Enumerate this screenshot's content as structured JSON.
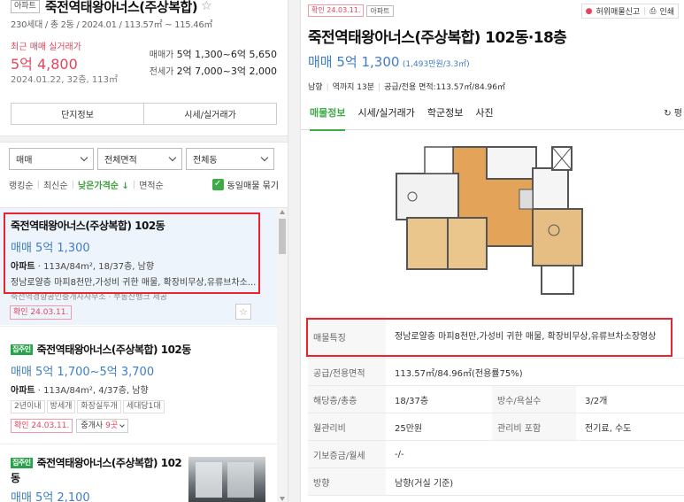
{
  "left": {
    "summary": {
      "type_tag": "아파트",
      "title": "죽전역태왕아너스(주상복합)",
      "sub_info": "230세대 / 총 2동 / 2024.01 / 113.57㎡ ~ 115.46㎡",
      "recent_label": "최근 매매 실거래가",
      "recent_price": "5억 4,800",
      "recent_date": "2024.01.22, 32층, 113㎡",
      "sale_label": "매매가",
      "sale_range": "5억 1,300~6억 5,650",
      "jeonse_label": "전세가",
      "jeonse_range": "2억 7,000~3억 2,000",
      "btn_complex": "단지정보",
      "btn_price": "시세/실거래가"
    },
    "filters": {
      "deal": "매매",
      "area": "전체면적",
      "dong": "전체동"
    },
    "sort": {
      "options": [
        "랭킹순",
        "최신순",
        "낮은가격순 ↓",
        "면적순"
      ],
      "same_listing": "동일매물 묶기"
    },
    "items": [
      {
        "title": "죽전역태왕아너스(주상복합) 102동",
        "price": "매매 5억 1,300",
        "type": "아파트",
        "spec": "113A/84m², 18/37층, 남향",
        "desc": "정남로얄층 마피8천만,가성비 귀한 매물, 확장비무상,유류브차소...",
        "agent": "죽전역경향공인중개사사무소 · 부동산뱅크 제공",
        "confirm": "확인 24.03.11."
      },
      {
        "badge": "집주인",
        "title": "죽전역태왕아너스(주상복합) 102동",
        "price": "매매 5억 1,700~5억 3,700",
        "type": "아파트",
        "spec": "113A/84m², 4/37층, 남향",
        "tags": [
          "2년이내",
          "방세개",
          "화장실두개",
          "세대당1대"
        ],
        "confirm": "확인 24.03.11.",
        "agent_select": "중개사",
        "agent_count": "9곳"
      },
      {
        "badge": "집주인",
        "title": "죽전역태왕아너스(주상복합) 102동",
        "price": "매매 5억 2,100"
      }
    ]
  },
  "detail": {
    "confirm": "확인 24.03.11.",
    "type_tag": "아파트",
    "report": "허위매물신고",
    "print": "인쇄",
    "title": "죽전역태왕아너스(주상복합) 102동·18층",
    "price_big": "매매 5억 1,300",
    "price_small": "(1,493만원/3.3㎡)",
    "meta": [
      "남향",
      "역까지 13분",
      "공급/전용 면적:113.57㎡/84.96㎡"
    ],
    "tabs": [
      "매물정보",
      "시세/실거래가",
      "학군정보",
      "사진"
    ],
    "refresh": "평",
    "table": {
      "feature_label": "매물특징",
      "feature_value": "정남로얄층 마피8천만,가성비 귀한 매물, 확장비무상,유류브차소장영상",
      "area_label": "공급/전용면적",
      "area_value": "113.57㎡/84.96㎡(전용률75%)",
      "floor_label": "해당층/총층",
      "floor_value": "18/37층",
      "rooms_label": "방수/욕실수",
      "rooms_value": "3/2개",
      "fee_label": "월관리비",
      "fee_value": "25만원",
      "fee_incl_label": "관리비 포함",
      "fee_incl_value": "전기료, 수도",
      "deposit_label": "기보증금/월세",
      "deposit_value": "-/-",
      "dir_label": "방향",
      "dir_value": "남향(거실 기준)"
    }
  },
  "colors": {
    "accent_green": "#3dab48",
    "price_blue": "#3e7dc8",
    "red": "#e4455b",
    "highlight_box": "#e8242f"
  }
}
